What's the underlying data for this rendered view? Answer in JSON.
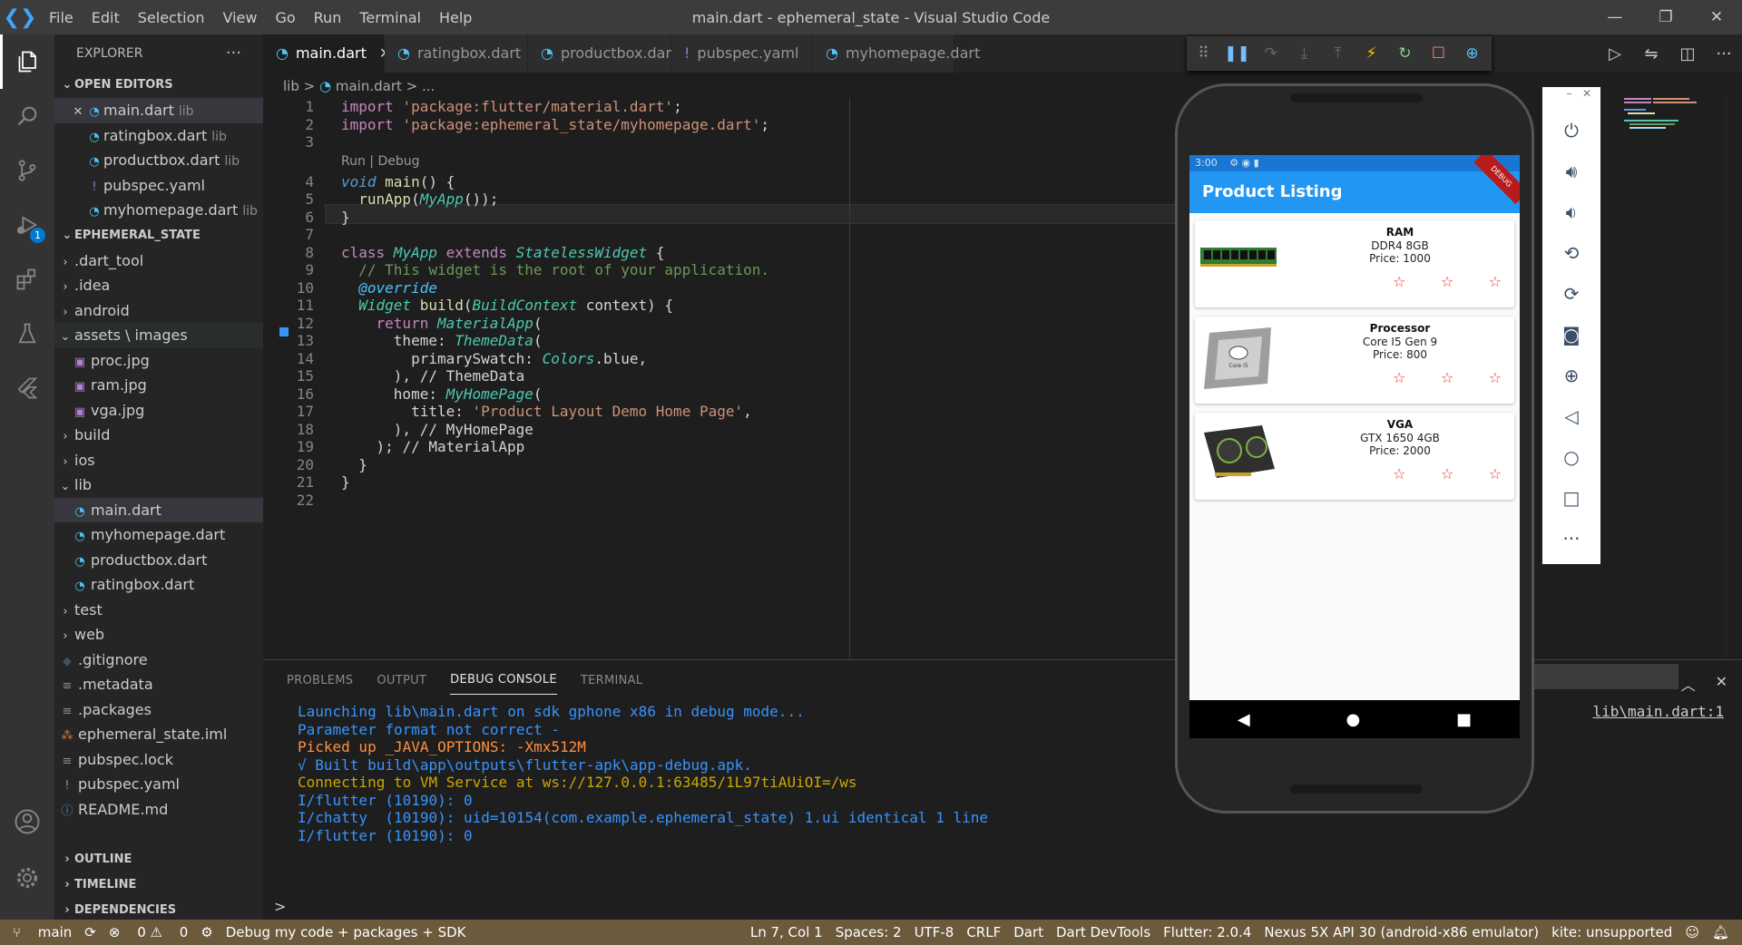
{
  "title": "main.dart - ephemeral_state - Visual Studio Code",
  "menu": [
    "File",
    "Edit",
    "Selection",
    "View",
    "Go",
    "Run",
    "Terminal",
    "Help"
  ],
  "window_controls": [
    "—",
    "❐",
    "✕"
  ],
  "activity": {
    "debug_badge": "1"
  },
  "explorer": {
    "header": "EXPLORER",
    "header_more": "···",
    "open_editors_label": "OPEN EDITORS",
    "open_editors": [
      {
        "name": "main.dart",
        "hint": "lib",
        "icon": "dart"
      },
      {
        "name": "ratingbox.dart",
        "hint": "lib",
        "icon": "dart"
      },
      {
        "name": "productbox.dart",
        "hint": "lib",
        "icon": "dart"
      },
      {
        "name": "pubspec.yaml",
        "hint": "",
        "icon": "yaml"
      },
      {
        "name": "myhomepage.dart",
        "hint": "lib",
        "icon": "dart"
      }
    ],
    "workspace_label": "EPHEMERAL_STATE",
    "tree": [
      {
        "name": ".dart_tool",
        "type": "folder",
        "open": false,
        "indent": 1
      },
      {
        "name": ".idea",
        "type": "folder",
        "open": false,
        "indent": 1
      },
      {
        "name": "android",
        "type": "folder",
        "open": false,
        "indent": 1
      },
      {
        "name": "assets \\ images",
        "type": "folder",
        "open": true,
        "indent": 1
      },
      {
        "name": "proc.jpg",
        "type": "img",
        "indent": 2
      },
      {
        "name": "ram.jpg",
        "type": "img",
        "indent": 2
      },
      {
        "name": "vga.jpg",
        "type": "img",
        "indent": 2
      },
      {
        "name": "build",
        "type": "folder",
        "open": false,
        "indent": 1
      },
      {
        "name": "ios",
        "type": "folder",
        "open": false,
        "indent": 1
      },
      {
        "name": "lib",
        "type": "folder",
        "open": true,
        "indent": 1
      },
      {
        "name": "main.dart",
        "type": "dart",
        "indent": 2,
        "selected": true
      },
      {
        "name": "myhomepage.dart",
        "type": "dart",
        "indent": 2
      },
      {
        "name": "productbox.dart",
        "type": "dart",
        "indent": 2
      },
      {
        "name": "ratingbox.dart",
        "type": "dart",
        "indent": 2
      },
      {
        "name": "test",
        "type": "folder",
        "open": false,
        "indent": 1
      },
      {
        "name": "web",
        "type": "folder",
        "open": false,
        "indent": 1
      },
      {
        "name": ".gitignore",
        "type": "git",
        "indent": 1
      },
      {
        "name": ".metadata",
        "type": "lines",
        "indent": 1
      },
      {
        "name": ".packages",
        "type": "lines",
        "indent": 1
      },
      {
        "name": "ephemeral_state.iml",
        "type": "rss",
        "indent": 1
      },
      {
        "name": "pubspec.lock",
        "type": "lines",
        "indent": 1
      },
      {
        "name": "pubspec.yaml",
        "type": "yaml",
        "indent": 1
      },
      {
        "name": "README.md",
        "type": "info",
        "indent": 1
      }
    ],
    "bottom_sections": [
      "OUTLINE",
      "TIMELINE",
      "DEPENDENCIES"
    ]
  },
  "tabs": [
    {
      "label": "main.dart",
      "icon": "dart",
      "active": true,
      "close": "✕"
    },
    {
      "label": "ratingbox.dart",
      "icon": "dart"
    },
    {
      "label": "productbox.dart",
      "icon": "dart"
    },
    {
      "label": "pubspec.yaml",
      "icon": "yaml"
    },
    {
      "label": "myhomepage.dart",
      "icon": "dart"
    }
  ],
  "breadcrumb": {
    "folder": "lib",
    "sep": ">",
    "file": "main.dart",
    "tail": "> ..."
  },
  "editor": {
    "codelens": "Run | Debug",
    "lines": [
      [
        [
          "kw",
          "import "
        ],
        [
          "str",
          "'package:flutter/material.dart'"
        ],
        [
          "wh",
          ";"
        ]
      ],
      [
        [
          "kw",
          "import "
        ],
        [
          "str",
          "'package:ephemeral_state/myhomepage.dart'"
        ],
        [
          "wh",
          ";"
        ]
      ],
      [],
      [
        [
          "typ",
          "void "
        ],
        [
          "fn",
          "main"
        ],
        [
          "wh",
          "() {"
        ]
      ],
      [
        [
          "wh",
          "  "
        ],
        [
          "fn",
          "runApp"
        ],
        [
          "wh",
          "("
        ],
        [
          "cls",
          "MyApp"
        ],
        [
          "wh",
          "());"
        ]
      ],
      [
        [
          "wh",
          "}"
        ]
      ],
      [],
      [
        [
          "kw",
          "class "
        ],
        [
          "cls",
          "MyApp "
        ],
        [
          "kw",
          "extends "
        ],
        [
          "cls",
          "StatelessWidget"
        ],
        [
          "wh",
          " {"
        ]
      ],
      [
        [
          "wh",
          "  "
        ],
        [
          "com",
          "// This widget is the root of your application."
        ]
      ],
      [
        [
          "wh",
          "  "
        ],
        [
          "ann",
          "@override"
        ]
      ],
      [
        [
          "wh",
          "  "
        ],
        [
          "cls",
          "Widget "
        ],
        [
          "fn",
          "build"
        ],
        [
          "wh",
          "("
        ],
        [
          "cls",
          "BuildContext"
        ],
        [
          "wh",
          " context) {"
        ]
      ],
      [
        [
          "wh",
          "    "
        ],
        [
          "kw",
          "return "
        ],
        [
          "cls",
          "MaterialApp"
        ],
        [
          "wh",
          "("
        ]
      ],
      [
        [
          "wh",
          "      "
        ],
        [
          "wh",
          "theme"
        ],
        [
          "wh",
          ": "
        ],
        [
          "cls",
          "ThemeData"
        ],
        [
          "wh",
          "("
        ]
      ],
      [
        [
          "wh",
          "        "
        ],
        [
          "wh",
          "primarySwatch"
        ],
        [
          "wh",
          ": "
        ],
        [
          "cls",
          "Colors"
        ],
        [
          "wh",
          ".blue,"
        ]
      ],
      [
        [
          "wh",
          "      ), "
        ],
        [
          "wh",
          "// ThemeData"
        ]
      ],
      [
        [
          "wh",
          "      "
        ],
        [
          "wh",
          "home"
        ],
        [
          "wh",
          ": "
        ],
        [
          "cls",
          "MyHomePage"
        ],
        [
          "wh",
          "("
        ]
      ],
      [
        [
          "wh",
          "        "
        ],
        [
          "wh",
          "title"
        ],
        [
          "wh",
          ": "
        ],
        [
          "str",
          "'Product Layout Demo Home Page'"
        ],
        [
          "wh",
          ","
        ]
      ],
      [
        [
          "wh",
          "      ), "
        ],
        [
          "wh",
          "// MyHomePage"
        ]
      ],
      [
        [
          "wh",
          "    ); "
        ],
        [
          "wh",
          "// MaterialApp"
        ]
      ],
      [
        [
          "wh",
          "  }"
        ]
      ],
      [
        [
          "wh",
          "}"
        ]
      ],
      []
    ]
  },
  "panel": {
    "tabs": [
      "PROBLEMS",
      "OUTPUT",
      "DEBUG CONSOLE",
      "TERMINAL"
    ],
    "active_tab": "DEBUG CONSOLE",
    "source_link": "lib\\main.dart:1",
    "console": [
      {
        "text": "Launching lib\\main.dart on sdk gphone x86 in debug mode...",
        "color": "blue"
      },
      {
        "text": "Parameter format not correct -",
        "color": "blue"
      },
      {
        "text": "Picked up _JAVA_OPTIONS: -Xmx512M",
        "color": "orange"
      },
      {
        "text": "√ Built build\\app\\outputs\\flutter-apk\\app-debug.apk.",
        "color": "blue"
      },
      {
        "text": "Connecting to VM Service at ws://127.0.0.1:63485/1L97tiAUiOI=/ws",
        "color": "yellow"
      },
      {
        "text": "I/flutter (10190): 0",
        "color": "blue"
      },
      {
        "text": "I/chatty  (10190): uid=10154(com.example.ephemeral_state) 1.ui identical 1 line",
        "color": "blue"
      },
      {
        "text": "I/flutter (10190): 0",
        "color": "blue"
      }
    ],
    "prompt": ">"
  },
  "status": {
    "branch": "main",
    "errors": "0",
    "warnings": "0",
    "debug": "Debug my code + packages + SDK",
    "position": "Ln 7, Col 1",
    "spaces": "Spaces: 2",
    "encoding": "UTF-8",
    "eol": "CRLF",
    "lang": "Dart",
    "devtools": "Dart DevTools",
    "flutter": "Flutter: 2.0.4",
    "device": "Nexus 5X API 30 (android-x86 emulator)",
    "kite": "kite: unsupported"
  },
  "phone": {
    "time": "3:00",
    "debug_ribbon": "DEBUG",
    "app_title": "Product Listing",
    "products": [
      {
        "name": "RAM",
        "desc": "DDR4 8GB",
        "price": "Price: 1000",
        "image": "ram"
      },
      {
        "name": "Processor",
        "desc": "Core I5 Gen 9",
        "price": "Price: 800",
        "image": "processor"
      },
      {
        "name": "VGA",
        "desc": "GTX 1650 4GB",
        "price": "Price: 2000",
        "image": "vga"
      }
    ],
    "star_glyph": "☆"
  },
  "emulator_tools": [
    "power-icon",
    "volume-up-icon",
    "volume-down-icon",
    "rotate-left-icon",
    "rotate-right-icon",
    "camera-icon",
    "zoom-icon",
    "back-icon",
    "home-icon",
    "overview-icon",
    "more-icon"
  ]
}
